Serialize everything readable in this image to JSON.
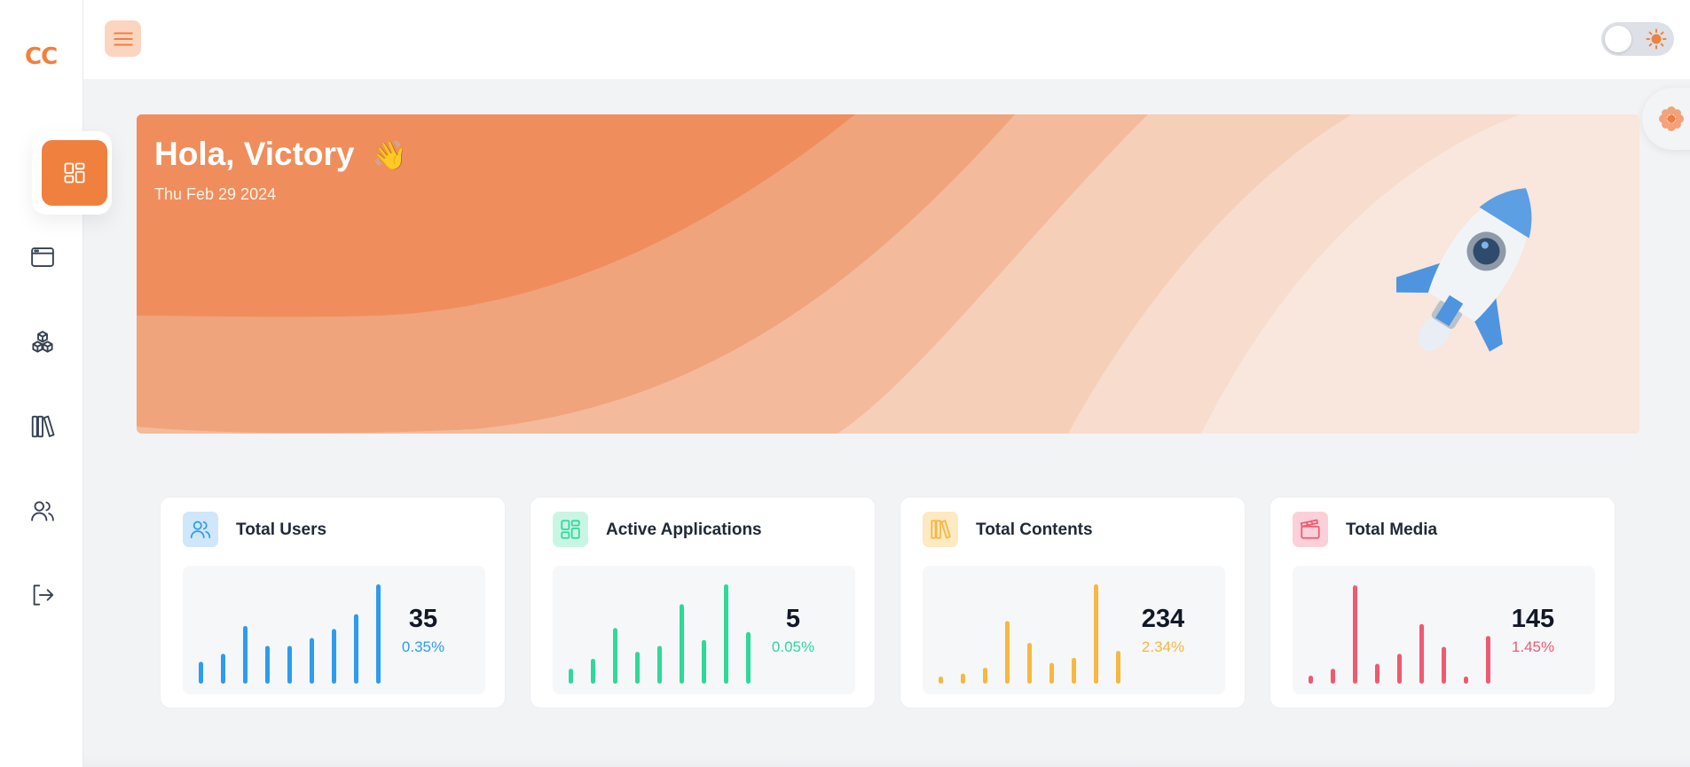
{
  "app": {
    "logo": "CC"
  },
  "sidebar": {
    "items": [
      {
        "name": "dashboard",
        "icon": "grid-icon",
        "active": true
      },
      {
        "name": "applications",
        "icon": "browser-window-icon"
      },
      {
        "name": "contents",
        "icon": "cubes-icon"
      },
      {
        "name": "library",
        "icon": "books-icon"
      },
      {
        "name": "users",
        "icon": "users-icon"
      },
      {
        "name": "logout",
        "icon": "logout-icon"
      }
    ]
  },
  "header": {
    "menu_icon": "hamburger-icon",
    "theme_toggle": {
      "state": "light",
      "icon": "sun-icon"
    }
  },
  "hero": {
    "greeting": "Hola, Victory",
    "wave_emoji": "👋",
    "date": "Thu Feb 29 2024",
    "illustration": "rocket"
  },
  "colors": {
    "accent": "#f0803e",
    "blue": "#2d9cf0",
    "green": "#2ed99a",
    "amber": "#f7b740",
    "red": "#ef5a71"
  },
  "stats": [
    {
      "title": "Total Users",
      "value": "35",
      "percent": "0.35%",
      "color": "#2d9cf0",
      "icon_bg": "#cfe6fb",
      "icon": "users-icon",
      "bars": [
        0.22,
        0.3,
        0.58,
        0.38,
        0.38,
        0.46,
        0.55,
        0.7,
        1.0
      ]
    },
    {
      "title": "Active Applications",
      "value": "5",
      "percent": "0.05%",
      "color": "#2ed99a",
      "icon_bg": "#c9f6e3",
      "icon": "grid-icon",
      "bars": [
        0.15,
        0.25,
        0.56,
        0.32,
        0.38,
        0.8,
        0.44,
        1.0,
        0.52
      ]
    },
    {
      "title": "Total Contents",
      "value": "234",
      "percent": "2.34%",
      "color": "#f7b740",
      "icon_bg": "#fde9c2",
      "icon": "books-icon",
      "bars": [
        0.05,
        0.1,
        0.16,
        0.63,
        0.41,
        0.21,
        0.26,
        1.0,
        0.33
      ]
    },
    {
      "title": "Total Media",
      "value": "145",
      "percent": "1.45%",
      "color": "#ef5a71",
      "icon_bg": "#fbd0d8",
      "icon": "clapperboard-icon",
      "bars": [
        0.08,
        0.15,
        0.99,
        0.2,
        0.3,
        0.6,
        0.37,
        0.07,
        0.48
      ]
    }
  ]
}
